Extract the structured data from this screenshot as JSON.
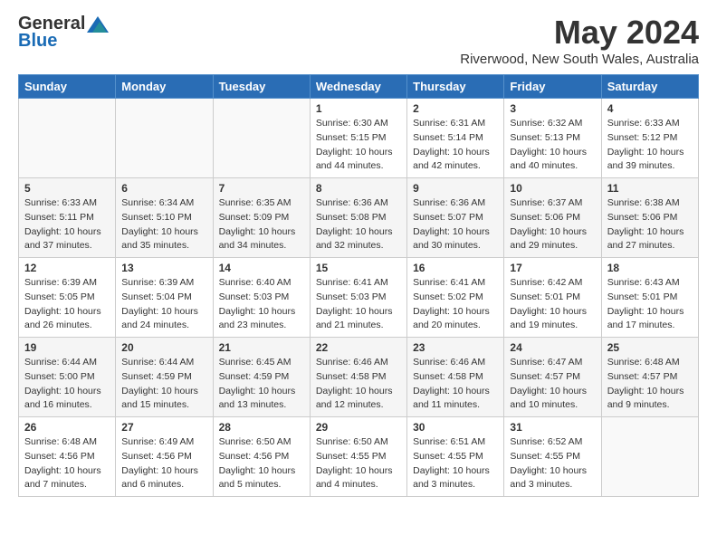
{
  "header": {
    "logo_general": "General",
    "logo_blue": "Blue",
    "month_title": "May 2024",
    "location": "Riverwood, New South Wales, Australia"
  },
  "weekdays": [
    "Sunday",
    "Monday",
    "Tuesday",
    "Wednesday",
    "Thursday",
    "Friday",
    "Saturday"
  ],
  "weeks": [
    [
      {
        "day": "",
        "info": ""
      },
      {
        "day": "",
        "info": ""
      },
      {
        "day": "",
        "info": ""
      },
      {
        "day": "1",
        "info": "Sunrise: 6:30 AM\nSunset: 5:15 PM\nDaylight: 10 hours\nand 44 minutes."
      },
      {
        "day": "2",
        "info": "Sunrise: 6:31 AM\nSunset: 5:14 PM\nDaylight: 10 hours\nand 42 minutes."
      },
      {
        "day": "3",
        "info": "Sunrise: 6:32 AM\nSunset: 5:13 PM\nDaylight: 10 hours\nand 40 minutes."
      },
      {
        "day": "4",
        "info": "Sunrise: 6:33 AM\nSunset: 5:12 PM\nDaylight: 10 hours\nand 39 minutes."
      }
    ],
    [
      {
        "day": "5",
        "info": "Sunrise: 6:33 AM\nSunset: 5:11 PM\nDaylight: 10 hours\nand 37 minutes."
      },
      {
        "day": "6",
        "info": "Sunrise: 6:34 AM\nSunset: 5:10 PM\nDaylight: 10 hours\nand 35 minutes."
      },
      {
        "day": "7",
        "info": "Sunrise: 6:35 AM\nSunset: 5:09 PM\nDaylight: 10 hours\nand 34 minutes."
      },
      {
        "day": "8",
        "info": "Sunrise: 6:36 AM\nSunset: 5:08 PM\nDaylight: 10 hours\nand 32 minutes."
      },
      {
        "day": "9",
        "info": "Sunrise: 6:36 AM\nSunset: 5:07 PM\nDaylight: 10 hours\nand 30 minutes."
      },
      {
        "day": "10",
        "info": "Sunrise: 6:37 AM\nSunset: 5:06 PM\nDaylight: 10 hours\nand 29 minutes."
      },
      {
        "day": "11",
        "info": "Sunrise: 6:38 AM\nSunset: 5:06 PM\nDaylight: 10 hours\nand 27 minutes."
      }
    ],
    [
      {
        "day": "12",
        "info": "Sunrise: 6:39 AM\nSunset: 5:05 PM\nDaylight: 10 hours\nand 26 minutes."
      },
      {
        "day": "13",
        "info": "Sunrise: 6:39 AM\nSunset: 5:04 PM\nDaylight: 10 hours\nand 24 minutes."
      },
      {
        "day": "14",
        "info": "Sunrise: 6:40 AM\nSunset: 5:03 PM\nDaylight: 10 hours\nand 23 minutes."
      },
      {
        "day": "15",
        "info": "Sunrise: 6:41 AM\nSunset: 5:03 PM\nDaylight: 10 hours\nand 21 minutes."
      },
      {
        "day": "16",
        "info": "Sunrise: 6:41 AM\nSunset: 5:02 PM\nDaylight: 10 hours\nand 20 minutes."
      },
      {
        "day": "17",
        "info": "Sunrise: 6:42 AM\nSunset: 5:01 PM\nDaylight: 10 hours\nand 19 minutes."
      },
      {
        "day": "18",
        "info": "Sunrise: 6:43 AM\nSunset: 5:01 PM\nDaylight: 10 hours\nand 17 minutes."
      }
    ],
    [
      {
        "day": "19",
        "info": "Sunrise: 6:44 AM\nSunset: 5:00 PM\nDaylight: 10 hours\nand 16 minutes."
      },
      {
        "day": "20",
        "info": "Sunrise: 6:44 AM\nSunset: 4:59 PM\nDaylight: 10 hours\nand 15 minutes."
      },
      {
        "day": "21",
        "info": "Sunrise: 6:45 AM\nSunset: 4:59 PM\nDaylight: 10 hours\nand 13 minutes."
      },
      {
        "day": "22",
        "info": "Sunrise: 6:46 AM\nSunset: 4:58 PM\nDaylight: 10 hours\nand 12 minutes."
      },
      {
        "day": "23",
        "info": "Sunrise: 6:46 AM\nSunset: 4:58 PM\nDaylight: 10 hours\nand 11 minutes."
      },
      {
        "day": "24",
        "info": "Sunrise: 6:47 AM\nSunset: 4:57 PM\nDaylight: 10 hours\nand 10 minutes."
      },
      {
        "day": "25",
        "info": "Sunrise: 6:48 AM\nSunset: 4:57 PM\nDaylight: 10 hours\nand 9 minutes."
      }
    ],
    [
      {
        "day": "26",
        "info": "Sunrise: 6:48 AM\nSunset: 4:56 PM\nDaylight: 10 hours\nand 7 minutes."
      },
      {
        "day": "27",
        "info": "Sunrise: 6:49 AM\nSunset: 4:56 PM\nDaylight: 10 hours\nand 6 minutes."
      },
      {
        "day": "28",
        "info": "Sunrise: 6:50 AM\nSunset: 4:56 PM\nDaylight: 10 hours\nand 5 minutes."
      },
      {
        "day": "29",
        "info": "Sunrise: 6:50 AM\nSunset: 4:55 PM\nDaylight: 10 hours\nand 4 minutes."
      },
      {
        "day": "30",
        "info": "Sunrise: 6:51 AM\nSunset: 4:55 PM\nDaylight: 10 hours\nand 3 minutes."
      },
      {
        "day": "31",
        "info": "Sunrise: 6:52 AM\nSunset: 4:55 PM\nDaylight: 10 hours\nand 3 minutes."
      },
      {
        "day": "",
        "info": ""
      }
    ]
  ]
}
